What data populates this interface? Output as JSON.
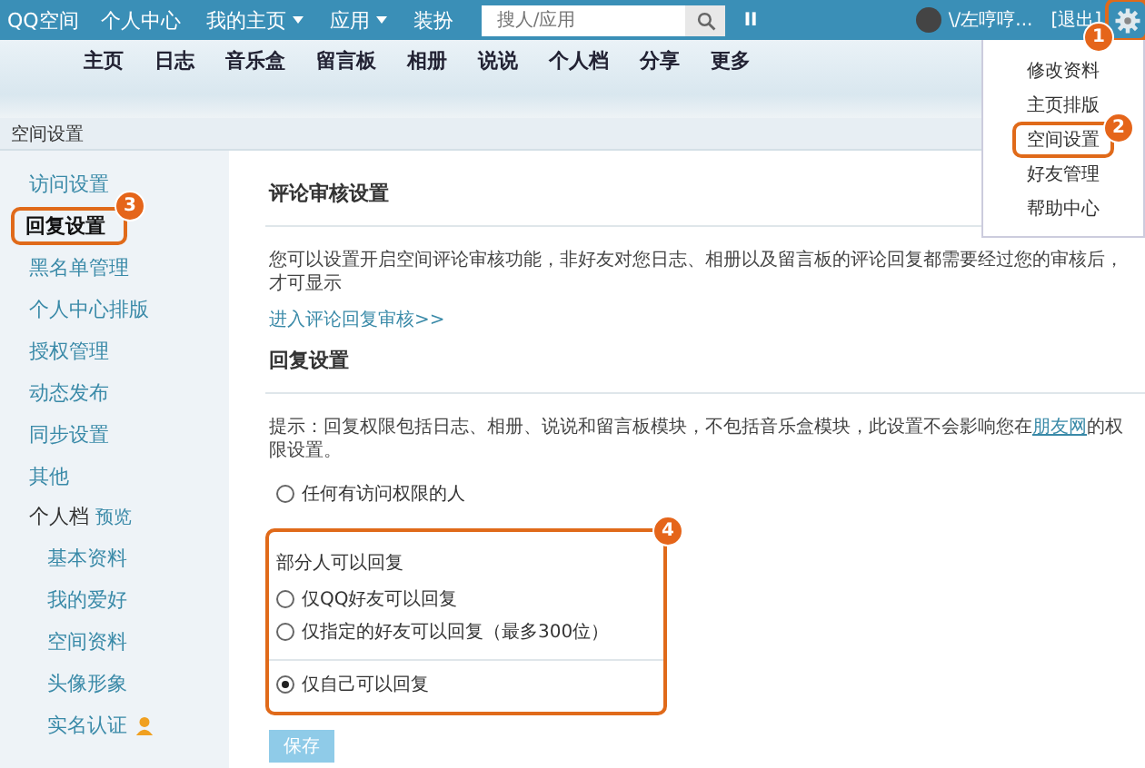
{
  "top_bar": {
    "logo": "QQ空间",
    "menu": [
      {
        "label": "个人中心",
        "dropdown": false
      },
      {
        "label": "我的主页",
        "dropdown": true
      },
      {
        "label": "应用",
        "dropdown": true
      },
      {
        "label": "装扮",
        "dropdown": false
      }
    ],
    "search": {
      "placeholder": "搜人/应用"
    },
    "player": "II",
    "user": "\\/左哼哼...",
    "logout": "[退出]",
    "gear_callout": "1"
  },
  "nav": [
    "主页",
    "日志",
    "音乐盒",
    "留言板",
    "相册",
    "说说",
    "个人档",
    "分享",
    "更多"
  ],
  "settings_menu": [
    {
      "label": "修改资料"
    },
    {
      "label": "主页排版"
    },
    {
      "label": "空间设置",
      "callout": "2"
    },
    {
      "label": "好友管理"
    },
    {
      "label": "帮助中心"
    }
  ],
  "section_title": "空间设置",
  "sidebar": {
    "items": [
      {
        "label": "访问设置",
        "selected": false
      },
      {
        "label": "回复设置",
        "selected": true,
        "callout": "3"
      },
      {
        "label": "黑名单管理",
        "selected": false
      },
      {
        "label": "个人中心排版",
        "selected": false
      },
      {
        "label": "授权管理",
        "selected": false
      },
      {
        "label": "动态发布",
        "selected": false
      },
      {
        "label": "同步设置",
        "selected": false
      },
      {
        "label": "其他",
        "selected": false
      }
    ],
    "profile": {
      "label": "个人档",
      "link": "预览",
      "children": [
        {
          "label": "基本资料",
          "verified_icon": false
        },
        {
          "label": "我的爱好",
          "verified_icon": false
        },
        {
          "label": "空间资料",
          "verified_icon": false
        },
        {
          "label": "头像形象",
          "verified_icon": false
        },
        {
          "label": "实名认证",
          "verified_icon": true
        }
      ]
    }
  },
  "review": {
    "heading": "评论审核设置",
    "text": "您可以设置开启空间评论审核功能，非好友对您日志、相册以及留言板的评论回复都需要经过您的审核后，才可显示",
    "link": "进入评论回复审核>>"
  },
  "reply": {
    "heading": "回复设置",
    "hint_before": "提示：回复权限包括日志、相册、说说和留言板模块，不包括音乐盒模块，此设置不会影响您在",
    "hint_link": "朋友网",
    "hint_after": "的权限设置。",
    "options": [
      {
        "label": "任何有访问权限的人",
        "selected": false
      }
    ],
    "group": {
      "title": "部分人可以回复",
      "callout": "4",
      "options": [
        {
          "label": "仅QQ好友可以回复",
          "selected": false
        },
        {
          "label": "仅指定的好友可以回复（最多300位）",
          "selected": false
        }
      ],
      "last": {
        "label": "仅自己可以回复",
        "selected": true
      }
    },
    "save": "保存"
  }
}
